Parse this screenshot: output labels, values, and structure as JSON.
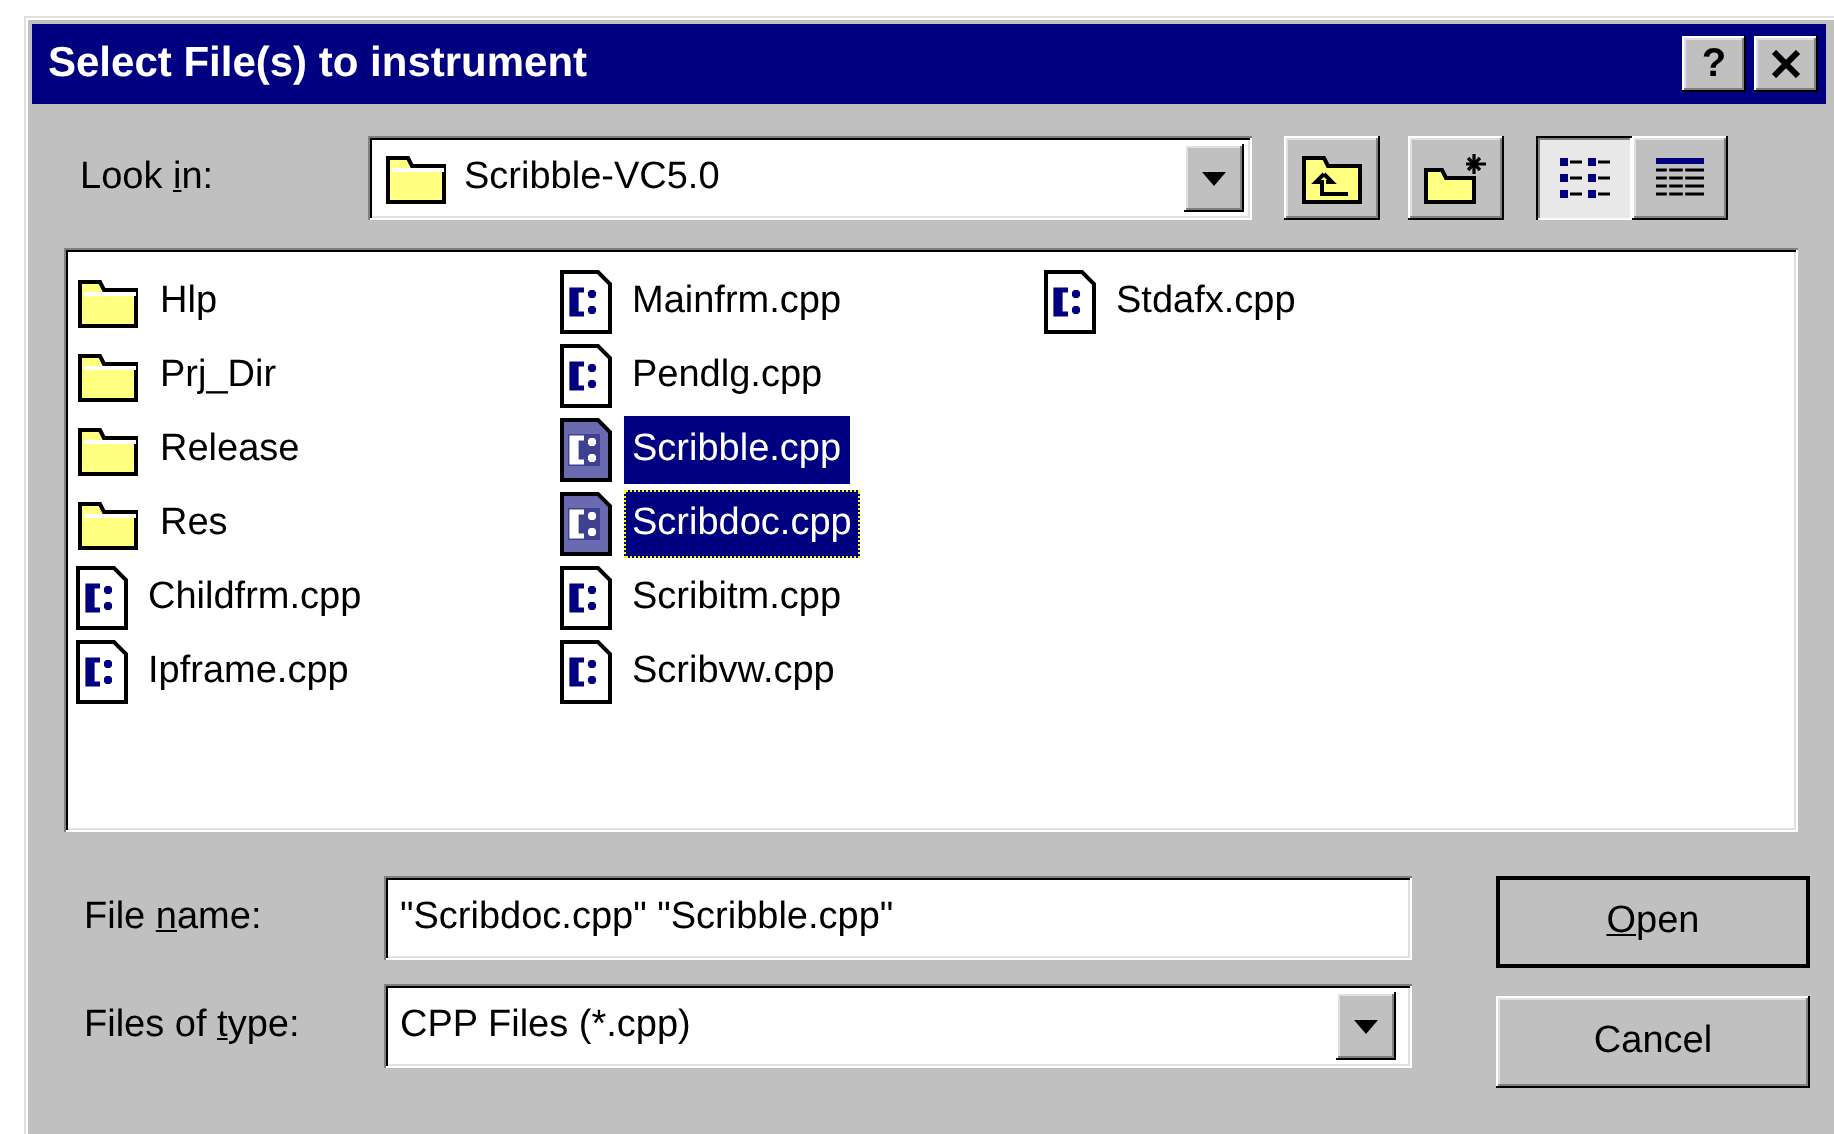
{
  "window": {
    "title": "Select File(s) to instrument",
    "help_button": "?"
  },
  "look_in": {
    "label": {
      "before": "Look ",
      "access_key": "i",
      "after": "n:"
    },
    "value": "Scribble-VC5.0"
  },
  "view_modes": [
    {
      "kind": "list",
      "selected": true
    },
    {
      "kind": "details",
      "selected": false
    }
  ],
  "files": [
    {
      "name": "Hlp",
      "kind": "folder",
      "selected": false,
      "focused": false
    },
    {
      "name": "Prj_Dir",
      "kind": "folder",
      "selected": false,
      "focused": false
    },
    {
      "name": "Release",
      "kind": "folder",
      "selected": false,
      "focused": false
    },
    {
      "name": "Res",
      "kind": "folder",
      "selected": false,
      "focused": false
    },
    {
      "name": "Childfrm.cpp",
      "kind": "cpp",
      "selected": false,
      "focused": false
    },
    {
      "name": "Ipframe.cpp",
      "kind": "cpp",
      "selected": false,
      "focused": false
    },
    {
      "name": "Mainfrm.cpp",
      "kind": "cpp",
      "selected": false,
      "focused": false
    },
    {
      "name": "Pendlg.cpp",
      "kind": "cpp",
      "selected": false,
      "focused": false
    },
    {
      "name": "Scribble.cpp",
      "kind": "cpp",
      "selected": true,
      "focused": false
    },
    {
      "name": "Scribdoc.cpp",
      "kind": "cpp",
      "selected": true,
      "focused": true
    },
    {
      "name": "Scribitm.cpp",
      "kind": "cpp",
      "selected": false,
      "focused": false
    },
    {
      "name": "Scribvw.cpp",
      "kind": "cpp",
      "selected": false,
      "focused": false
    },
    {
      "name": "Stdafx.cpp",
      "kind": "cpp",
      "selected": false,
      "focused": false
    }
  ],
  "file_name": {
    "label": {
      "before": "File ",
      "access_key": "n",
      "after": "ame:"
    },
    "value": "\"Scribdoc.cpp\" \"Scribble.cpp\""
  },
  "file_type": {
    "label": {
      "before": "Files of ",
      "access_key": "t",
      "after": "ype:"
    },
    "value": "CPP Files (*.cpp)"
  },
  "buttons": [
    {
      "label": {
        "access_key": "O",
        "after": "pen"
      },
      "default": true
    },
    {
      "label": {
        "after": "Cancel"
      },
      "default": false
    }
  ]
}
